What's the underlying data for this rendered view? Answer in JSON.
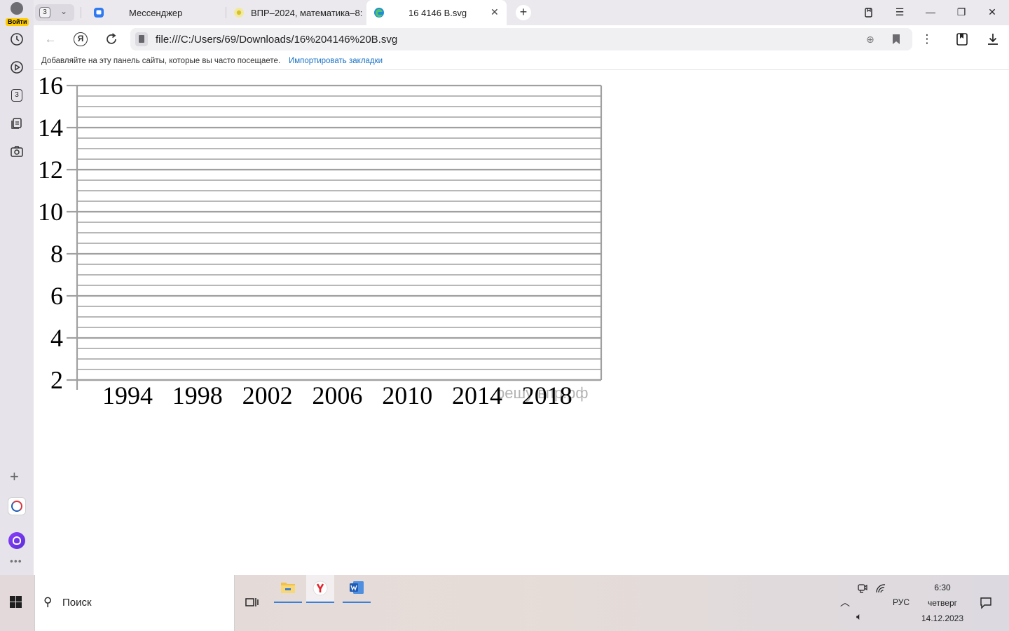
{
  "browser": {
    "account_label": "Войти",
    "tab_count": "3",
    "tabs": [
      {
        "label": "Мессенджер"
      },
      {
        "label": "ВПР–2024, математика–8:"
      },
      {
        "label": "16 4146 B.svg"
      }
    ],
    "address_url": "file:///C:/Users/69/Downloads/16%204146%20B.svg",
    "bookmarks_hint": "Добавляйте на эту панель сайты, которые вы часто посещаете.",
    "bookmarks_import": "Импортировать закладки",
    "sidebar_badge": "3"
  },
  "chart_data": {
    "type": "line",
    "categories": [
      "1994",
      "1998",
      "2002",
      "2006",
      "2010",
      "2014",
      "2018"
    ],
    "series": [],
    "ylim": [
      2,
      16
    ],
    "yticks": [
      "2",
      "4",
      "6",
      "8",
      "10",
      "12",
      "14",
      "16"
    ],
    "grid": true,
    "watermark": "решу впр.рф"
  },
  "taskbar": {
    "search_label": "Поиск",
    "language": "РУС",
    "time": "6:30",
    "weekday": "четверг",
    "date": "14.12.2023"
  }
}
